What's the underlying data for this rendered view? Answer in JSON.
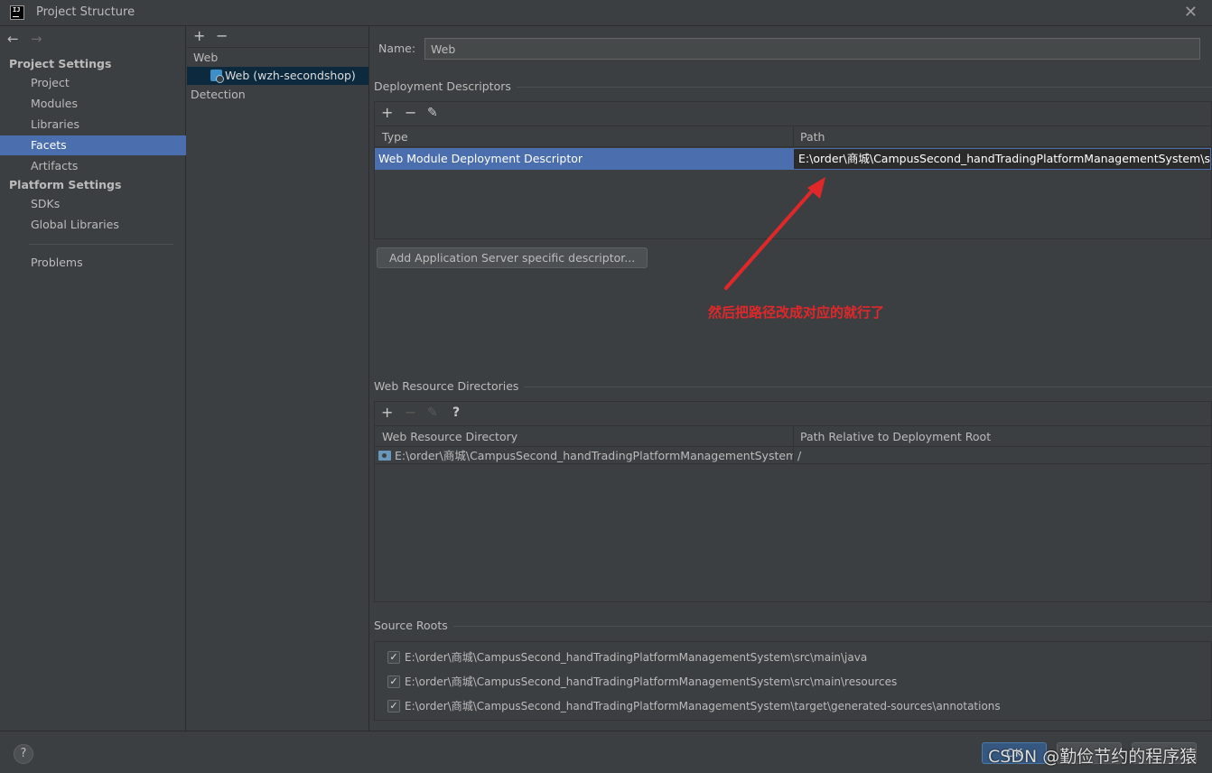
{
  "window": {
    "title": "Project Structure",
    "close_glyph": "✕",
    "logo_text": "IJ"
  },
  "nav": {
    "back": "←",
    "forward": "→"
  },
  "sidebar": {
    "project_settings_header": "Project Settings",
    "project_items": [
      "Project",
      "Modules",
      "Libraries",
      "Facets",
      "Artifacts"
    ],
    "platform_settings_header": "Platform Settings",
    "platform_items": [
      "SDKs",
      "Global Libraries"
    ],
    "problems": "Problems",
    "selected": "Facets"
  },
  "facets_panel": {
    "add": "+",
    "remove": "−",
    "group_web": "Web",
    "web_item": "Web (wzh-secondshop)",
    "detection": "Detection"
  },
  "facet": {
    "name_label": "Name:",
    "name_value": "Web"
  },
  "deployment_descriptors": {
    "title": "Deployment Descriptors",
    "toolbar": {
      "add": "+",
      "remove": "−",
      "edit": "✎"
    },
    "columns": [
      "Type",
      "Path"
    ],
    "rows": [
      {
        "type": "Web Module Deployment Descriptor",
        "path": "E:\\order\\商城\\CampusSecond_handTradingPlatformManagementSystem\\src\\main\\webapp\\WEB-INF\\web.xml"
      }
    ],
    "add_server_button": "Add Application Server specific descriptor..."
  },
  "annotation": {
    "text": "然后把路径改成对应的就行了",
    "color": "#e0282a"
  },
  "web_resource_directories": {
    "title": "Web Resource Directories",
    "toolbar": {
      "add": "+",
      "remove": "−",
      "edit": "✎",
      "help": "?"
    },
    "columns": [
      "Web Resource Directory",
      "Path Relative to Deployment Root"
    ],
    "rows": [
      {
        "directory": "E:\\order\\商城\\CampusSecond_handTradingPlatformManagementSystem\\...",
        "relative": "/"
      }
    ]
  },
  "source_roots": {
    "title": "Source Roots",
    "items": [
      {
        "checked": "✓",
        "path": "E:\\order\\商城\\CampusSecond_handTradingPlatformManagementSystem\\src\\main\\java"
      },
      {
        "checked": "✓",
        "path": "E:\\order\\商城\\CampusSecond_handTradingPlatformManagementSystem\\src\\main\\resources"
      },
      {
        "checked": "✓",
        "path": "E:\\order\\商城\\CampusSecond_handTradingPlatformManagementSystem\\target\\generated-sources\\annotations"
      }
    ]
  },
  "footer": {
    "help": "?",
    "ok": "OK",
    "watermark": "CSDN @勤俭节约的程序猿"
  },
  "colors": {
    "background": "#3c3f41",
    "selection": "#4b6eaf",
    "tree_selection": "#0d293e",
    "annotation": "#e0282a"
  }
}
